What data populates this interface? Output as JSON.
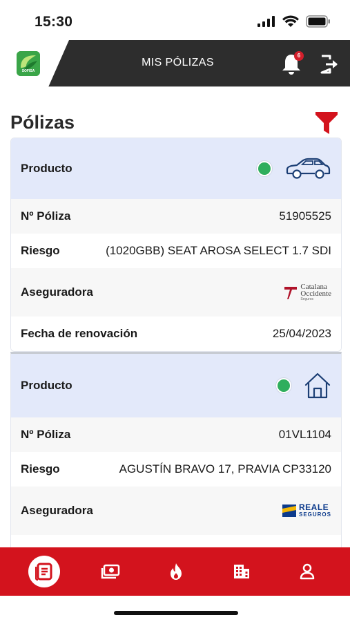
{
  "status_bar": {
    "time": "15:30",
    "icons": [
      "signal-icon",
      "wifi-icon",
      "battery-icon"
    ]
  },
  "header": {
    "logo_text": "SOFISA",
    "title": "MIS PÓLIZAS",
    "notification_count": "6",
    "icons": [
      "bell-icon",
      "logout-icon"
    ]
  },
  "page": {
    "title": "Pólizas",
    "filter_icon": "filter-icon"
  },
  "colors": {
    "accent_red": "#d3131d",
    "header_dark": "#2d2d2d",
    "status_green": "#2fae5d",
    "card_head": "#e3e9fa",
    "icon_blue": "#1b3e74"
  },
  "policies": [
    {
      "product_label": "Producto",
      "product_icon": "car-icon",
      "policy_label": "Nº Póliza",
      "policy_number": "51905525",
      "risk_label": "Riesgo",
      "risk_value": "(1020GBB) SEAT AROSA SELECT 1.7 SDI",
      "insurer_label": "Aseguradora",
      "insurer_logo": {
        "line1": "Catalana",
        "line2": "Occidente",
        "line3": "Seguros"
      },
      "renewal_label": "Fecha de renovación",
      "renewal_date": "25/04/2023"
    },
    {
      "product_label": "Producto",
      "product_icon": "house-icon",
      "policy_label": "Nº Póliza",
      "policy_number": "01VL1104",
      "risk_label": "Riesgo",
      "risk_value": "AGUSTÍN BRAVO 17, PRAVIA CP33120",
      "insurer_label": "Aseguradora",
      "insurer_logo": {
        "line1": "REALE",
        "line2": "SEGUROS"
      }
    }
  ],
  "bottom_nav": {
    "items": [
      "policies-icon",
      "money-icon",
      "flame-icon",
      "building-icon",
      "user-icon"
    ]
  }
}
